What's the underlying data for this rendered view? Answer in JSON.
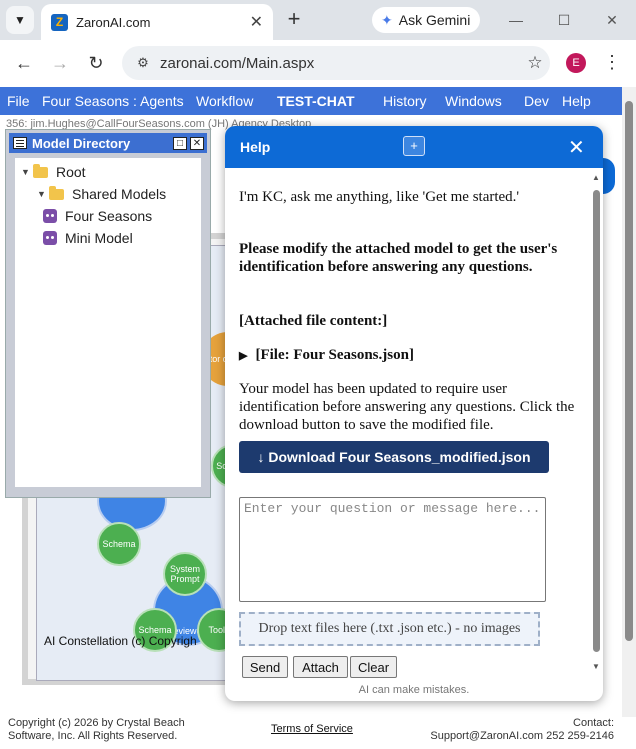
{
  "browser": {
    "tab_title": "ZaronAI.com",
    "favicon_letter": "Z",
    "gemini_label": "Ask Gemini",
    "url": "zaronai.com/Main.aspx",
    "profile_initial": "E"
  },
  "menubar": {
    "items": [
      "File",
      "Four Seasons : Agents",
      "Workflow",
      "TEST-CHAT",
      "History",
      "Windows",
      "Dev",
      "Help"
    ]
  },
  "subheader": "356: jim.Hughes@CallFourSeasons.com (JH) Agency Desktop",
  "canvas": {
    "nodes": [
      "Schema",
      "Schema",
      "System Prompt",
      "Reviewers",
      "Schema",
      "Tools",
      "Sch",
      "ctor dd"
    ],
    "caption": "AI Constellation (c) Copyrigh"
  },
  "model_directory": {
    "title": "Model Directory",
    "tree": [
      "Root",
      "Shared Models",
      "Four Seasons",
      "Mini Model"
    ]
  },
  "help": {
    "title": "Help",
    "plus_label": "+",
    "intro": "I'm KC, ask me anything, like 'Get me started.'",
    "request": "Please modify the attached model to get the user's identification before answering any questions.",
    "attached_heading": "[Attached file content:]",
    "file_label": "[File: Four Seasons.json]",
    "response": "Your model has been updated to require user identification before answering any questions. Click the download button to save the modified file.",
    "download_label": "↓ Download Four Seasons_modified.json",
    "question_placeholder": "Enter your question or message here...",
    "dropzone": "Drop text files here (.txt .json etc.) - no images",
    "send": "Send",
    "attach": "Attach",
    "clear": "Clear",
    "disclaimer": "AI can make mistakes."
  },
  "footer": {
    "copyright_line1": "Copyright (c) 2026 by Crystal Beach",
    "copyright_line2": "Software, Inc. All Rights Reserved.",
    "terms": "Terms of Service",
    "contact_label": "Contact:",
    "contact": "Support@ZaronAI.com  252 259-2146"
  }
}
